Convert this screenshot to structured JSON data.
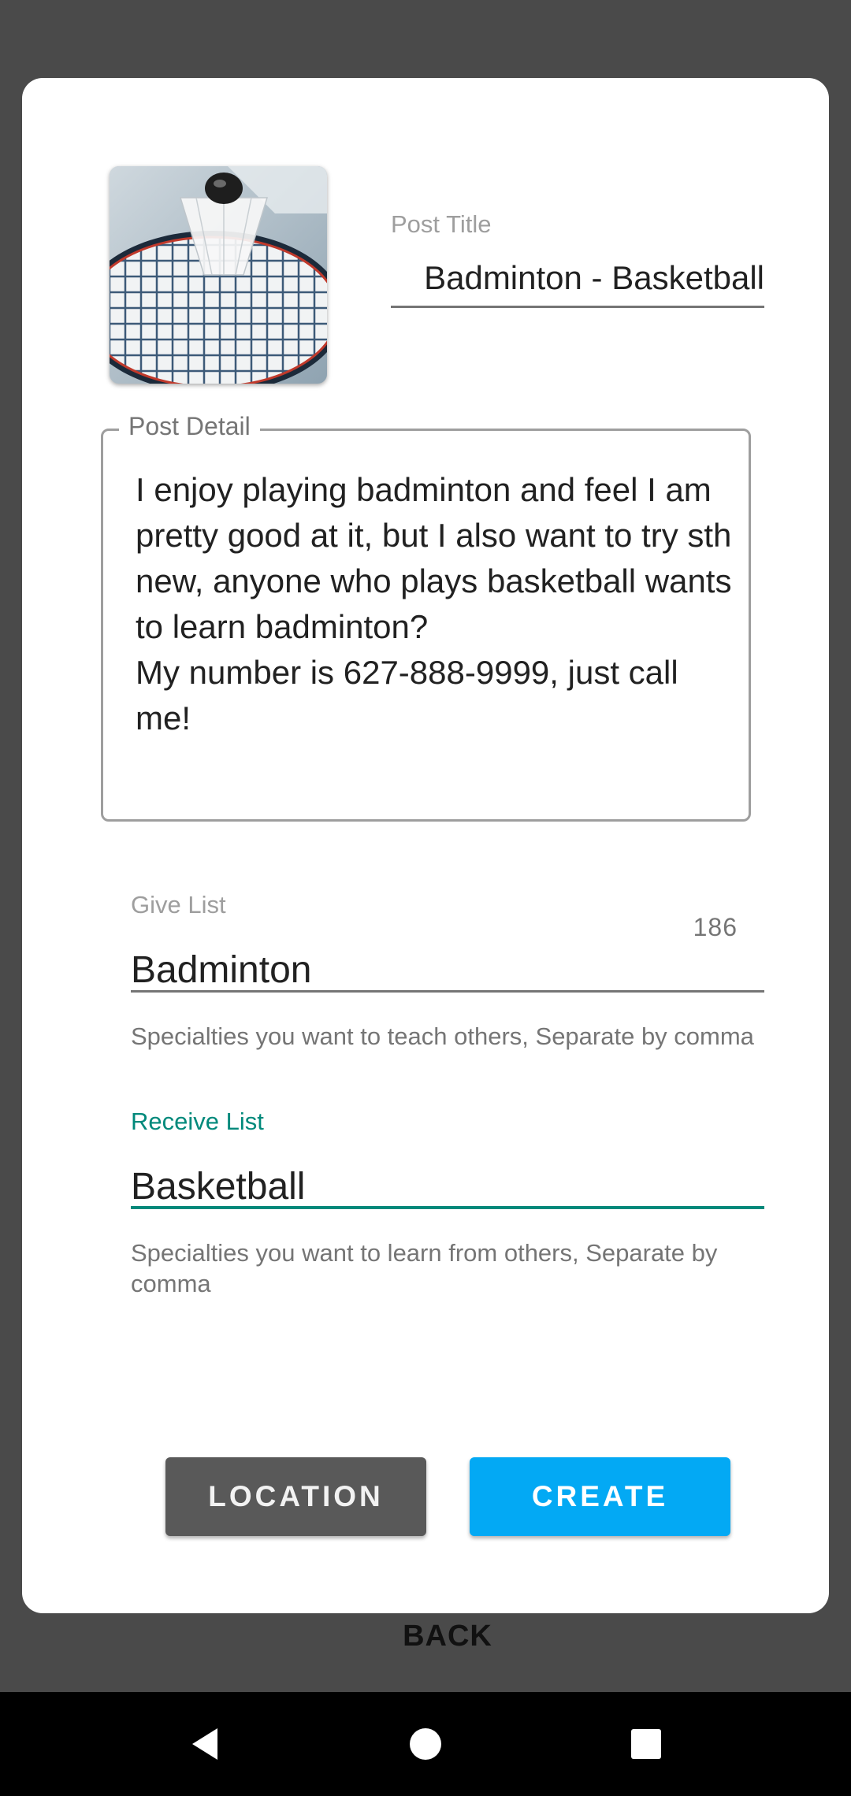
{
  "post": {
    "title_label": "Post Title",
    "title_value": "Badminton - Basketball",
    "detail_label": "Post Detail",
    "detail_value": "I enjoy playing badminton and feel I am pretty good at it, but I also want to try sth new, anyone who plays basketball wants to learn badminton?\nMy number is 627-888-9999, just call me!",
    "char_count": "186",
    "image_name": "badminton-racket-shuttlecock-photo"
  },
  "give": {
    "label": "Give List",
    "value": "Badminton",
    "helper": "Specialties you want to teach others, Separate by comma"
  },
  "receive": {
    "label": "Receive List",
    "value": "Basketball",
    "helper": "Specialties you want to learn from others, Separate by comma"
  },
  "buttons": {
    "location": "LOCATION",
    "create": "CREATE",
    "back": "BACK"
  },
  "navbar": {
    "back_icon": "triangle-back-icon",
    "home_icon": "circle-home-icon",
    "recent_icon": "square-recents-icon"
  },
  "colors": {
    "accent": "#00897b",
    "create_button": "#03a9f4",
    "location_button": "#595959",
    "scrim": "#4a4a4a"
  }
}
